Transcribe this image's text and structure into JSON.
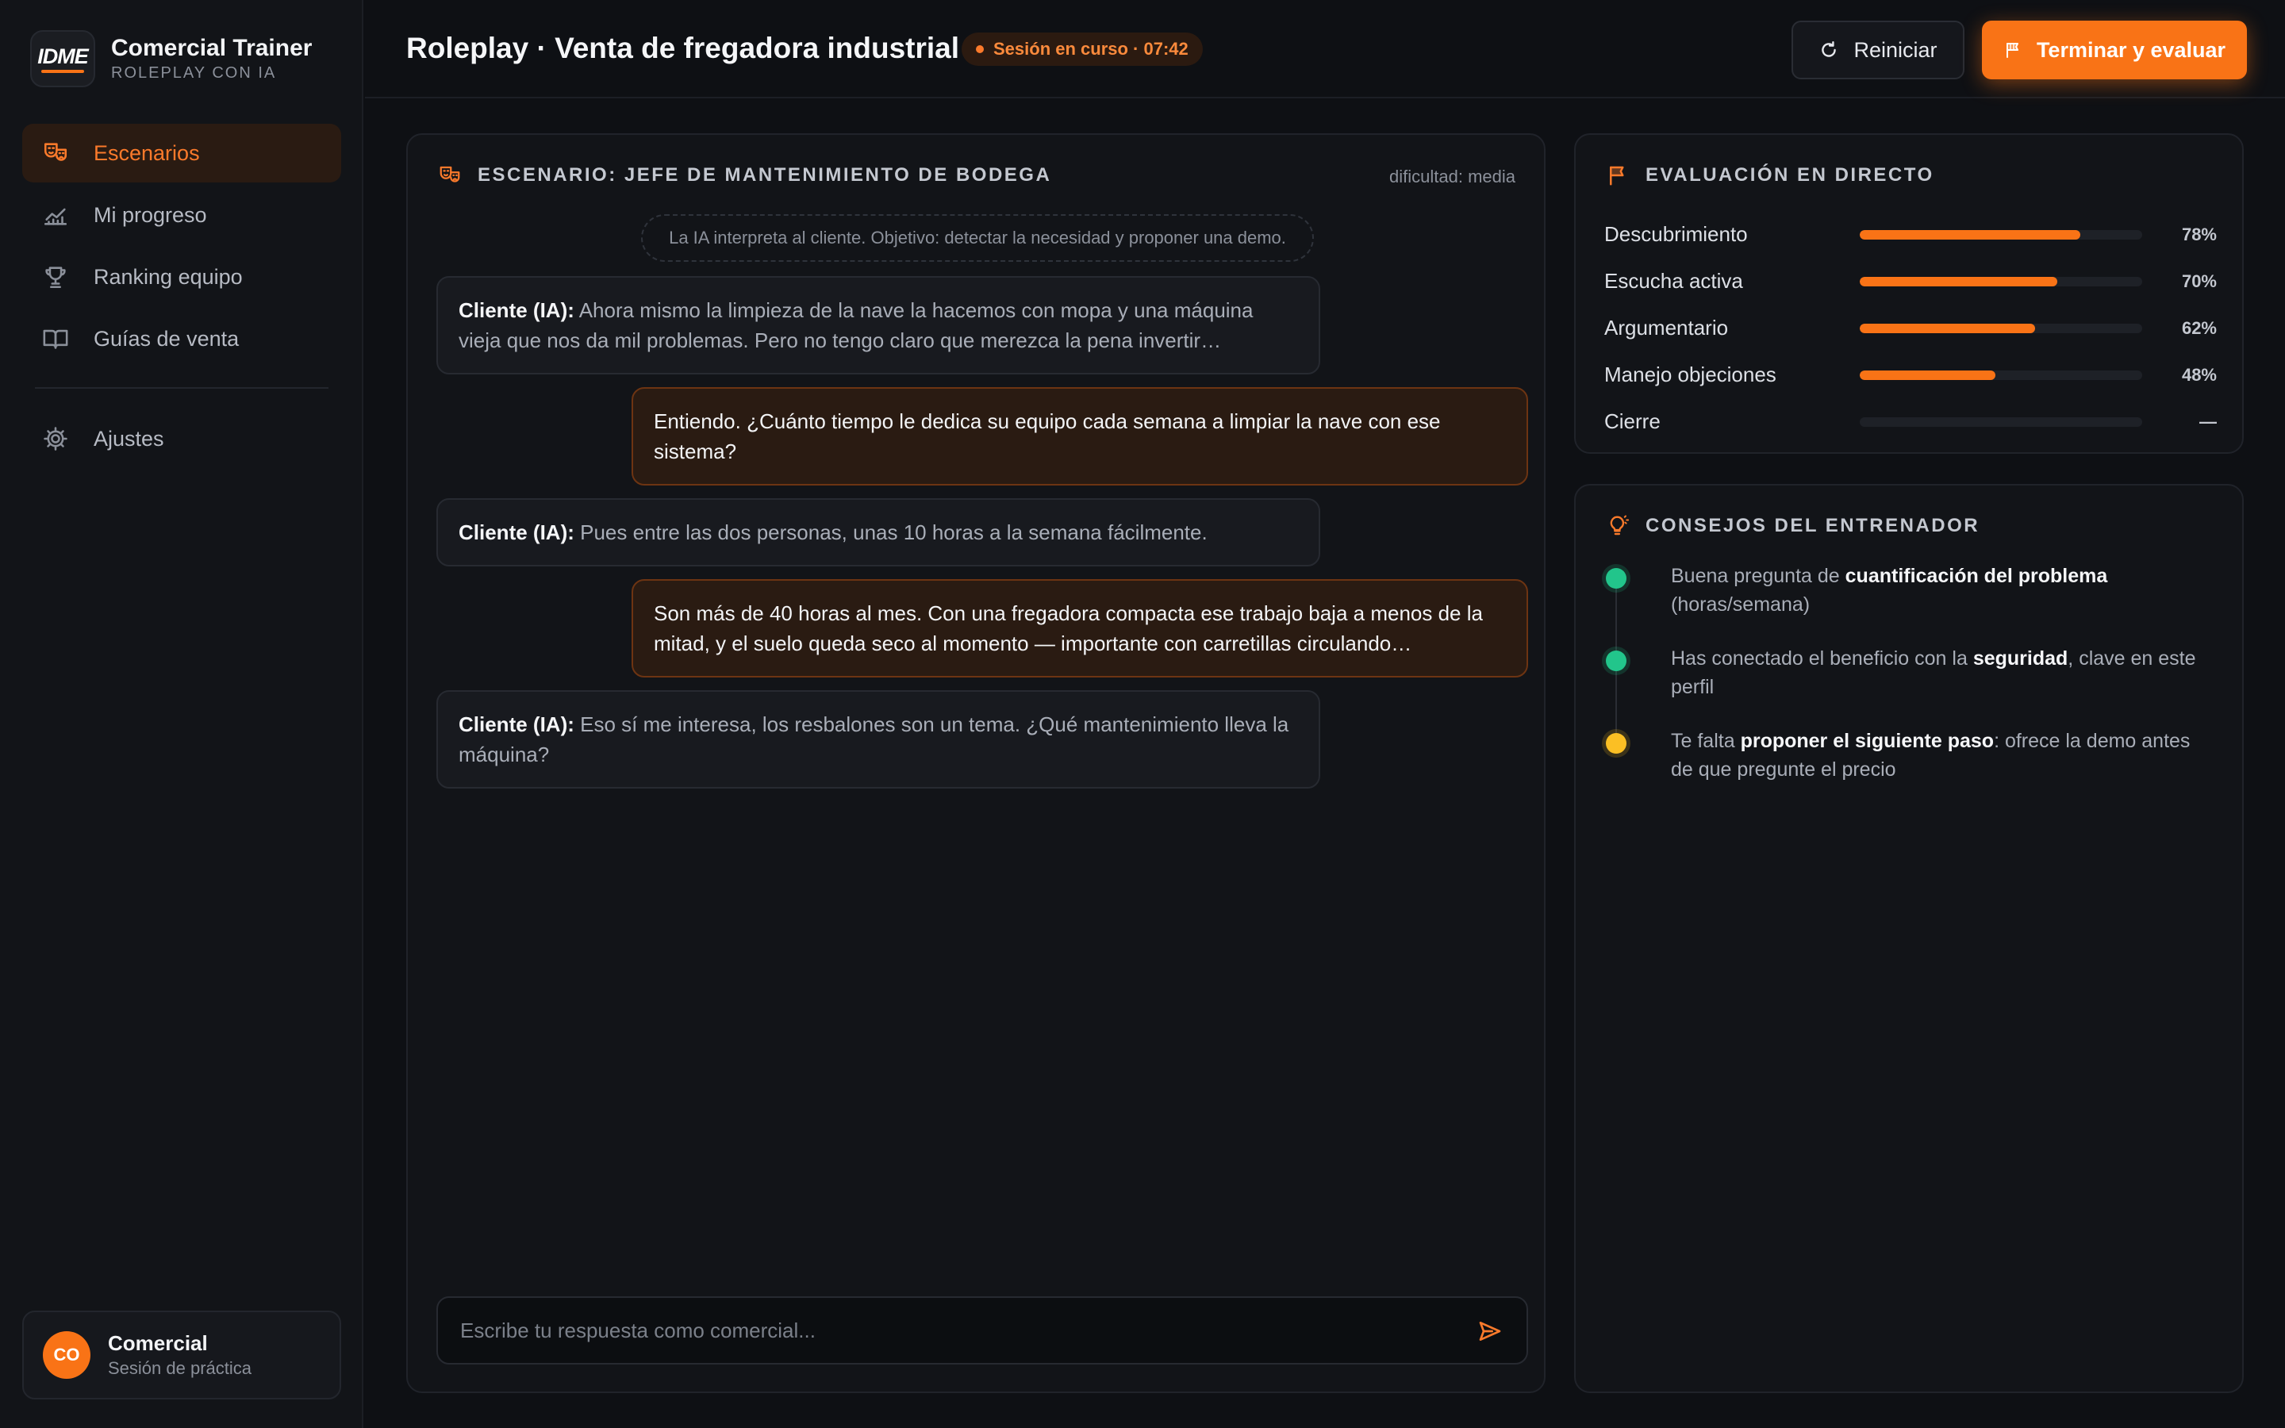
{
  "brand": {
    "logo_text": "IDME",
    "title": "Comercial Trainer",
    "subtitle": "ROLEPLAY CON IA"
  },
  "sidebar": {
    "items": [
      {
        "label": "Escenarios",
        "icon": "theater-masks-icon",
        "active": true
      },
      {
        "label": "Mi progreso",
        "icon": "chart-line-icon",
        "active": false
      },
      {
        "label": "Ranking equipo",
        "icon": "trophy-icon",
        "active": false
      },
      {
        "label": "Guías de venta",
        "icon": "book-open-icon",
        "active": false
      },
      {
        "label": "Ajustes",
        "icon": "gear-icon",
        "active": false
      }
    ],
    "user": {
      "initials": "CO",
      "name": "Comercial",
      "role": "Sesión de práctica"
    }
  },
  "header": {
    "title": "Roleplay · Venta de fregadora industrial",
    "session_badge": "Sesión en curso · 07:42",
    "restart_label": "Reiniciar",
    "finish_label": "Terminar y evaluar"
  },
  "chat": {
    "scenario_title": "ESCENARIO: JEFE DE MANTENIMIENTO DE BODEGA",
    "difficulty": "dificultad: media",
    "notice": "La IA interpreta al cliente. Objetivo: detectar la necesidad y proponer una demo.",
    "messages": [
      {
        "role": "ai",
        "speaker": "Cliente (IA):",
        "text": "Ahora mismo la limpieza de la nave la hacemos con mopa y una máquina vieja que nos da mil problemas. Pero no tengo claro que merezca la pena invertir…"
      },
      {
        "role": "user",
        "text": "Entiendo. ¿Cuánto tiempo le dedica su equipo cada semana a limpiar la nave con ese sistema?"
      },
      {
        "role": "ai",
        "speaker": "Cliente (IA):",
        "text": "Pues entre las dos personas, unas 10 horas a la semana fácilmente."
      },
      {
        "role": "user",
        "text": "Son más de 40 horas al mes. Con una fregadora compacta ese trabajo baja a menos de la mitad, y el suelo queda seco al momento — importante con carretillas circulando…"
      },
      {
        "role": "ai",
        "speaker": "Cliente (IA):",
        "text": "Eso sí me interesa, los resbalones son un tema. ¿Qué mantenimiento lleva la máquina?"
      }
    ],
    "composer_placeholder": "Escribe tu respuesta como comercial..."
  },
  "evaluation": {
    "title": "EVALUACIÓN EN DIRECTO",
    "metrics": [
      {
        "label": "Descubrimiento",
        "percent": 78,
        "display": "78%"
      },
      {
        "label": "Escucha activa",
        "percent": 70,
        "display": "70%"
      },
      {
        "label": "Argumentario",
        "percent": 62,
        "display": "62%"
      },
      {
        "label": "Manejo objeciones",
        "percent": 48,
        "display": "48%"
      },
      {
        "label": "Cierre",
        "percent": 0,
        "display": "—"
      }
    ]
  },
  "tips": {
    "title": "CONSEJOS DEL ENTRENADOR",
    "items": [
      {
        "status": "good",
        "pre": "Buena pregunta de ",
        "bold": "cuantificación del problema",
        "post": " (horas/semana)"
      },
      {
        "status": "good",
        "pre": "Has conectado el beneficio con la ",
        "bold": "seguridad",
        "post": ", clave en este perfil"
      },
      {
        "status": "warn",
        "pre": "Te falta ",
        "bold": "proponer el siguiente paso",
        "post": ": ofrece la demo antes de que pregunte el precio"
      }
    ]
  },
  "colors": {
    "accent": "#f97316",
    "good": "#22c58b",
    "warn": "#fbbf24",
    "background": "#0e1014"
  }
}
